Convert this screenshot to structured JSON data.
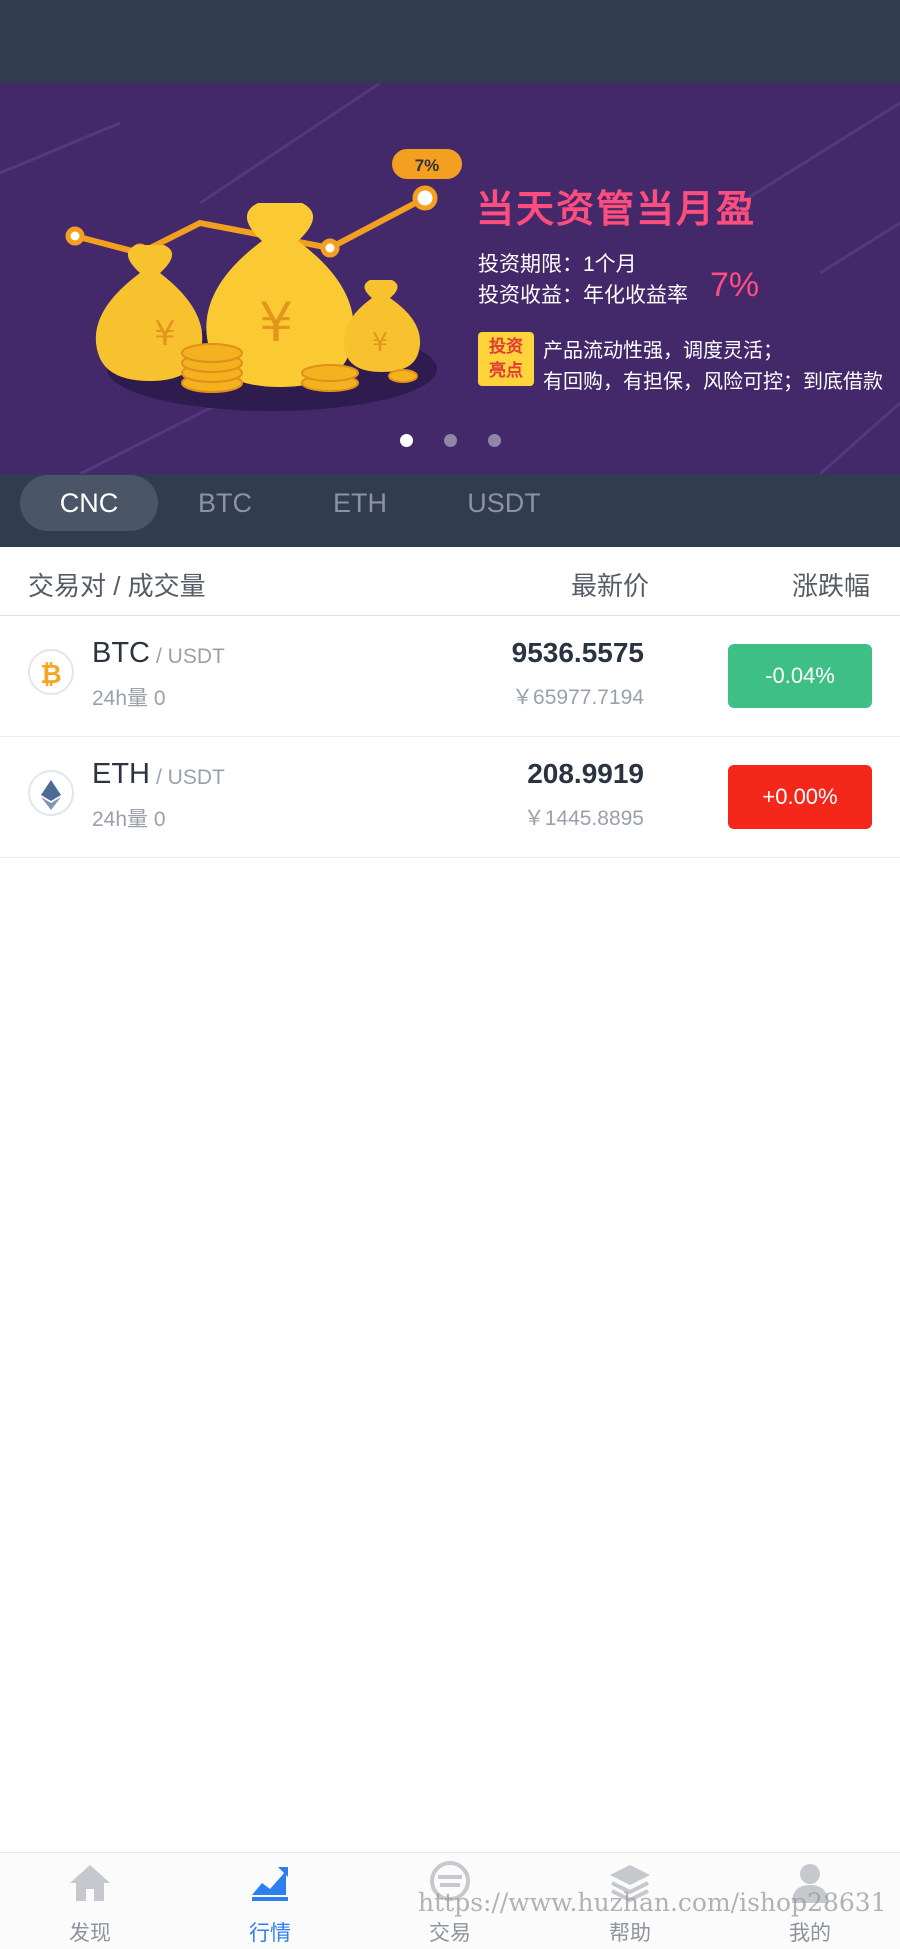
{
  "banner": {
    "badge_percent": "7%",
    "title": "当天资管当月盈",
    "line1": "投资期限：1个月",
    "line2_prefix": "投资收益：年化收益率",
    "line2_rate": "7%",
    "highlight_badge_line1": "投资",
    "highlight_badge_line2": "亮点",
    "feature1": "产品流动性强，调度灵活；",
    "feature2": "有回购，有担保，风险可控；到底借款",
    "slide_count": 3,
    "active_slide": 1
  },
  "tabs": [
    {
      "label": "CNC",
      "active": true
    },
    {
      "label": "BTC",
      "active": false
    },
    {
      "label": "ETH",
      "active": false
    },
    {
      "label": "USDT",
      "active": false
    }
  ],
  "table": {
    "col_pair": "交易对 / 成交量",
    "col_price": "最新价",
    "col_change": "涨跌幅"
  },
  "rows": [
    {
      "base": "BTC",
      "quote": "/ USDT",
      "volume": "24h量 0",
      "price": "9536.5575",
      "price_cny": "￥65977.7194",
      "change": "-0.04%",
      "change_color": "#3dbf86",
      "icon": "bitcoin-icon",
      "icon_color": "#f5a623"
    },
    {
      "base": "ETH",
      "quote": "/ USDT",
      "volume": "24h量 0",
      "price": "208.9919",
      "price_cny": "￥1445.8895",
      "change": "+0.00%",
      "change_color": "#f5271b",
      "icon": "ethereum-icon",
      "icon_color": "#4d6b96"
    }
  ],
  "nav": [
    {
      "label": "发现",
      "icon": "home-icon",
      "active": false
    },
    {
      "label": "行情",
      "icon": "chart-icon",
      "active": true
    },
    {
      "label": "交易",
      "icon": "exchange-icon",
      "active": false
    },
    {
      "label": "帮助",
      "icon": "layers-icon",
      "active": false
    },
    {
      "label": "我的",
      "icon": "user-icon",
      "active": false
    }
  ],
  "watermark": "https://www.huzhan.com/ishop28631",
  "colors": {
    "header_bg": "#323c4f",
    "banner_bg": "#43286a",
    "accent_pink": "#ff4d7d",
    "active_nav": "#2d7ff0"
  }
}
